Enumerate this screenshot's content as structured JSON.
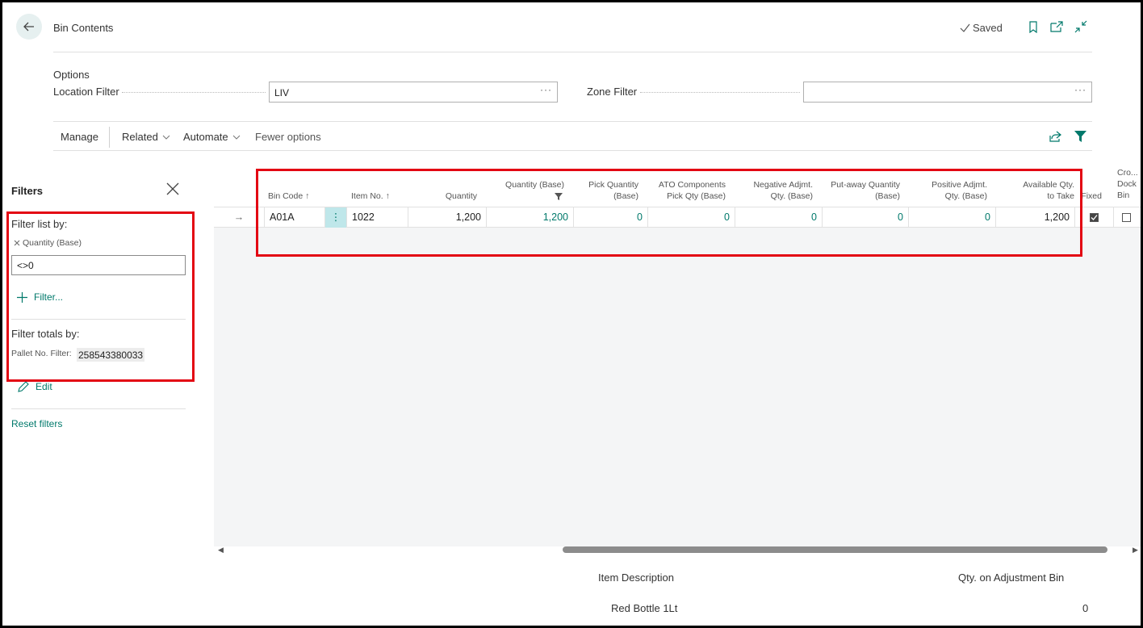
{
  "header": {
    "title": "Bin Contents",
    "saved_label": "Saved"
  },
  "options": {
    "title": "Options",
    "location_filter_label": "Location Filter",
    "location_filter_value": "LIV",
    "zone_filter_label": "Zone Filter",
    "zone_filter_value": "",
    "ellipsis": "···"
  },
  "actions": {
    "manage": "Manage",
    "related": "Related",
    "automate": "Automate",
    "fewer_options": "Fewer options"
  },
  "filter_pane": {
    "title": "Filters",
    "filter_list_by": "Filter list by:",
    "chip_label": "Quantity (Base)",
    "chip_value": "<>0",
    "add_filter": "Filter...",
    "filter_totals_by": "Filter totals by:",
    "pallet_label": "Pallet No. Filter:",
    "pallet_value": "258543380033",
    "edit": "Edit",
    "reset": "Reset filters"
  },
  "grid": {
    "columns": {
      "bin_code": "Bin Code",
      "item_no": "Item No.",
      "quantity": "Quantity",
      "quantity_base": "Quantity (Base)",
      "pick_qty_1": "Pick Quantity",
      "pick_qty_2": "(Base)",
      "ato_1": "ATO Components",
      "ato_2": "Pick Qty (Base)",
      "neg_1": "Negative Adjmt.",
      "neg_2": "Qty. (Base)",
      "put_1": "Put-away Quantity",
      "put_2": "(Base)",
      "pos_1": "Positive Adjmt.",
      "pos_2": "Qty. (Base)",
      "avail_1": "Available Qty.",
      "avail_2": "to Take",
      "fixed": "Fixed",
      "cross_1": "Cro...",
      "cross_2": "Dock",
      "cross_3": "Bin"
    },
    "rows": [
      {
        "bin_code": "A01A",
        "item_no": "1022",
        "quantity": "1,200",
        "quantity_base": "1,200",
        "pick_qty": "0",
        "ato_pick_qty": "0",
        "neg_adj_qty": "0",
        "put_away_qty": "0",
        "pos_adj_qty": "0",
        "available_qty": "1,200",
        "fixed": true,
        "cross_dock": false
      }
    ]
  },
  "factbox": {
    "item_description_label": "Item Description",
    "item_description_value": "Red Bottle 1Lt",
    "qty_adj_bin_label": "Qty. on Adjustment Bin",
    "qty_adj_bin_value": "0"
  },
  "colors": {
    "accent": "#00796b",
    "highlight_box": "#e30613"
  }
}
